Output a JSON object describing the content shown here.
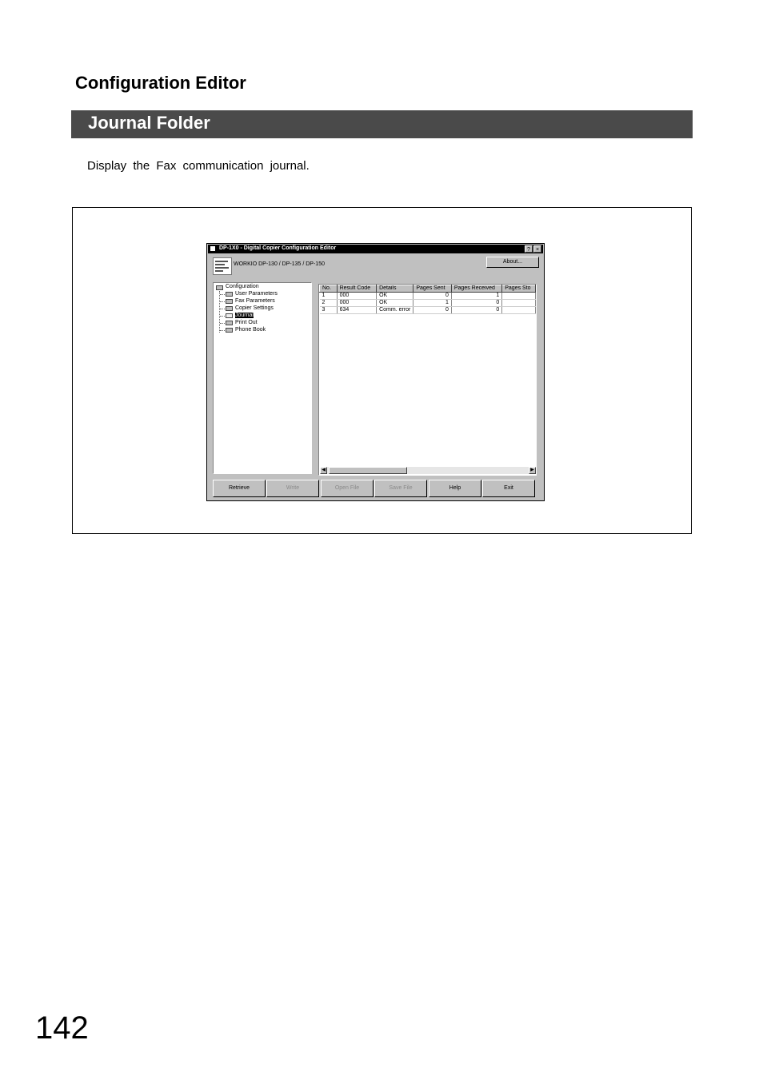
{
  "header": {
    "section": "Configuration Editor",
    "title": "Journal Folder"
  },
  "description": "Display the Fax communication journal.",
  "page_number": "142",
  "app": {
    "title": "DP-1X0 - Digital Copier Configuration Editor",
    "title_buttons": [
      "?",
      "×"
    ],
    "model": "WORKIO DP-130 / DP-135 / DP-150",
    "about_button": "About...",
    "tree": {
      "root": "Configuration",
      "items": [
        "User Parameters",
        "Fax Parameters",
        "Copier Settings",
        "Journal",
        "Print Out",
        "Phone Book"
      ],
      "selected": "Journal"
    },
    "journal": {
      "columns": [
        "No.",
        "Result Code",
        "Details",
        "Pages Sent",
        "Pages Received",
        "Pages Sto"
      ],
      "rows": [
        [
          "1",
          "000",
          "OK",
          "0",
          "1",
          ""
        ],
        [
          "2",
          "000",
          "OK",
          "1",
          "0",
          ""
        ],
        [
          "3",
          "634",
          "Comm. error",
          "0",
          "0",
          ""
        ]
      ]
    },
    "buttons": {
      "retrieve": "Retrieve",
      "write": "Write",
      "open_file": "Open File",
      "save_file": "Save File",
      "help": "Help",
      "exit": "Exit"
    }
  }
}
